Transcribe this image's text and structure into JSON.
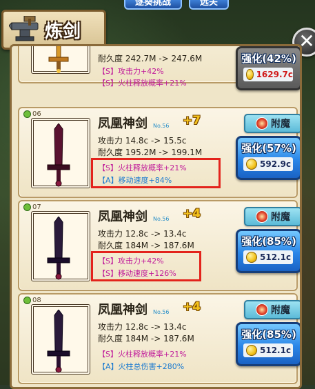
{
  "top_tabs": [
    "逐葵挑战",
    "远关"
  ],
  "title": "炼剑",
  "close_glyph": "✕",
  "colors": {
    "special": "#c01a9a",
    "attr_a": "#1a7ad0",
    "highlight": "#e3231c",
    "plus": "#f4c21c"
  },
  "partial_card": {
    "durability": "耐久度 242.7M -> 247.6M",
    "attrs": [
      "【S】攻击力+42%",
      "【S】火柱释放概率+21%"
    ],
    "upgrade_label": "强化(42%)",
    "cost": "1629.7c"
  },
  "cards": [
    {
      "index": "06",
      "name": "凤凰神剑",
      "level": "No.56",
      "plus": "+7",
      "attack": "攻击力 14.8c -> 15.5c",
      "durability": "耐久度 195.2M -> 199.1M",
      "attrs": [
        {
          "text": "【S】火柱释放概率+21%",
          "rank": "s"
        },
        {
          "text": "【A】移动速度+84%",
          "rank": "a"
        }
      ],
      "enchant_label": "附魔",
      "upgrade_label": "强化(57%)",
      "cost": "592.9c"
    },
    {
      "index": "07",
      "name": "凤凰神剑",
      "level": "No.56",
      "plus": "+4",
      "attack": "攻击力 12.8c -> 13.4c",
      "durability": "耐久度 184M -> 187.6M",
      "attrs": [
        {
          "text": "【S】攻击力+42%",
          "rank": "s"
        },
        {
          "text": "【S】移动速度+126%",
          "rank": "s"
        }
      ],
      "enchant_label": "附魔",
      "upgrade_label": "强化(85%)",
      "cost": "512.1c"
    },
    {
      "index": "08",
      "name": "凤凰神剑",
      "level": "No.56",
      "plus": "+4",
      "attack": "攻击力 12.8c -> 13.4c",
      "durability": "耐久度 184M -> 187.6M",
      "attrs": [
        {
          "text": "【S】火柱释放概率+21%",
          "rank": "s"
        },
        {
          "text": "【A】火柱总伤害+280%",
          "rank": "a"
        }
      ],
      "enchant_label": "附魔",
      "upgrade_label": "强化(85%)",
      "cost": "512.1c"
    }
  ]
}
